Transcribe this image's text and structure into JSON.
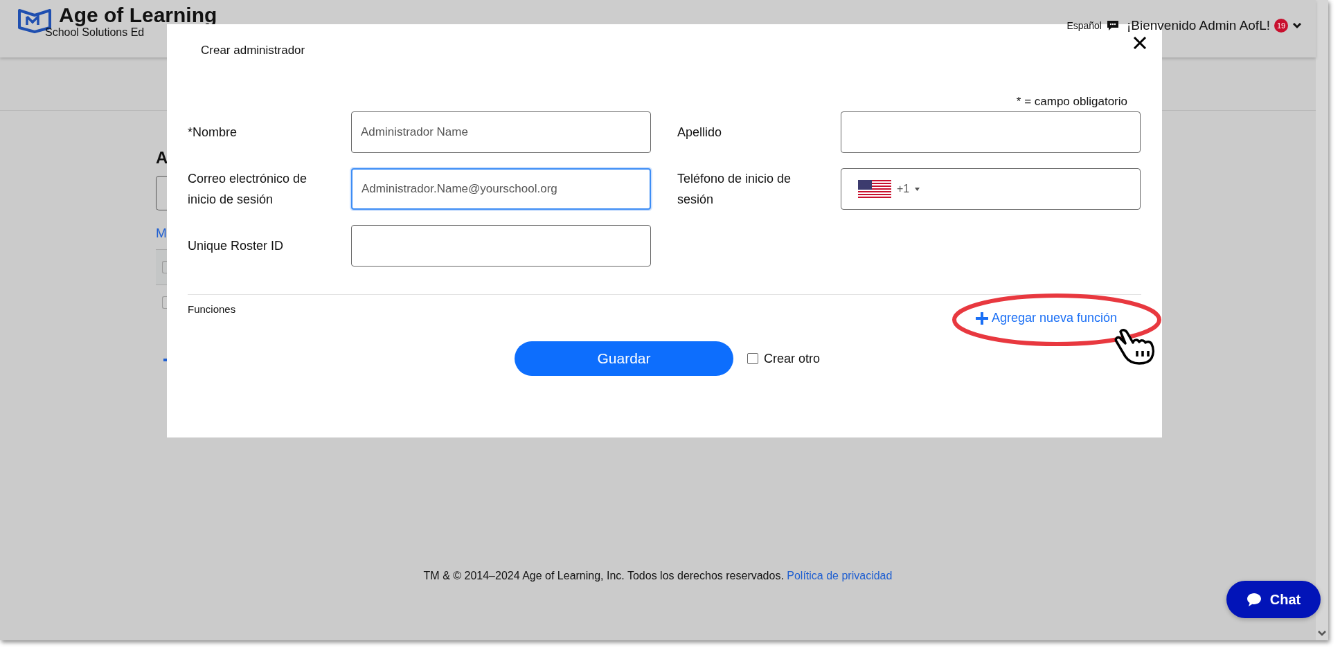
{
  "header": {
    "logo_title": "Age of Learning",
    "logo_subtitle": "School Solutions Ed",
    "language": "Español",
    "welcome": "¡Bienvenido Admin AofL!",
    "notification_count": "19"
  },
  "background_page": {
    "heading": "A",
    "link": "M",
    "rows": [
      {
        "checked": false
      },
      {
        "checked": false
      }
    ]
  },
  "modal": {
    "title": "Crear administrador",
    "required_note": "* = campo obligatorio",
    "fields": [
      {
        "label": "*Nombre",
        "kind": "text",
        "value": "Administrador Name",
        "focused": false
      },
      {
        "label": "Apellido",
        "kind": "text",
        "focused": false
      },
      {
        "label": "Correo electrónico de inicio de sesión",
        "kind": "text",
        "value": "Administrador.Name@yourschool.org",
        "focused": true
      },
      {
        "label": "Teléfono de inicio de sesión",
        "kind": "phone",
        "country_code": "+1",
        "focused": false
      },
      {
        "label": "Unique Roster ID",
        "kind": "text",
        "focused": false
      }
    ],
    "section_label": "Funciones",
    "add_link": "Agregar nueva función",
    "save_button": "Guardar",
    "create_another": {
      "label": "Crear otro",
      "checked": false
    }
  },
  "footer": {
    "text": "TM & © 2014–2024 Age of Learning, Inc. Todos los derechos reservados.",
    "link": "Política de privacidad"
  },
  "chat_button": "Chat"
}
